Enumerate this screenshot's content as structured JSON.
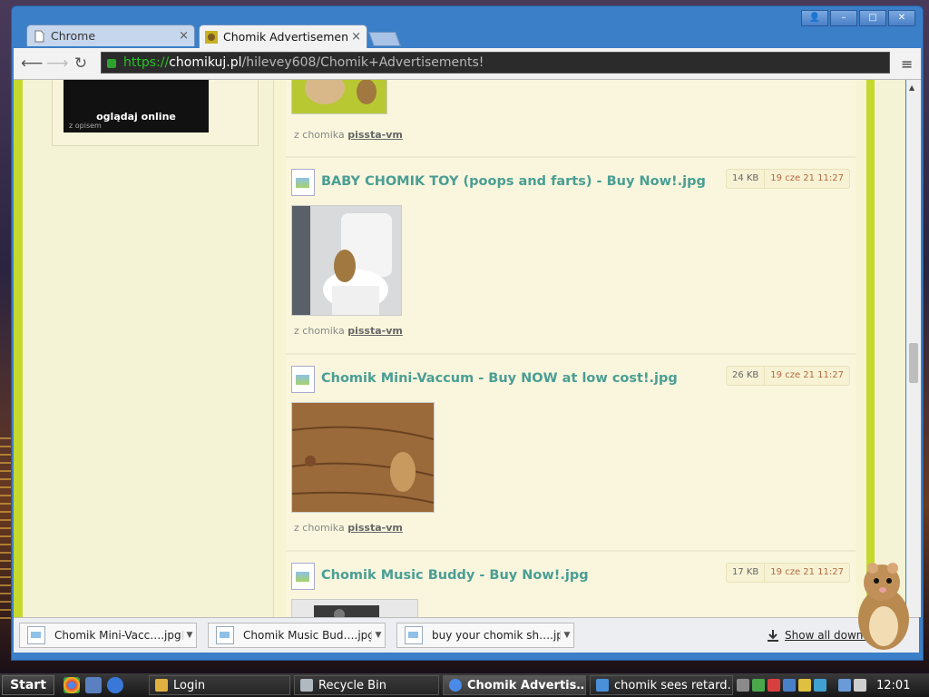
{
  "browser": {
    "tabs": [
      {
        "label": "Chrome",
        "close": "×"
      },
      {
        "label": "Chomik Advertisements!",
        "close": "×"
      }
    ],
    "url": {
      "scheme": "https://",
      "domain": "chomikuj.pl",
      "path": "/hilevey608/Chomik+Advertisements!"
    },
    "window_controls": [
      "👤",
      "–",
      "□",
      "✕"
    ]
  },
  "sidebar": {
    "overlay_text": "oglądaj online",
    "caption": "z opisem"
  },
  "entries": [
    {
      "from_label": "z chomika",
      "user": "pissta-vm"
    },
    {
      "title": "BABY CHOMIK TOY (poops and farts) - Buy Now!.jpg",
      "size": "14 KB",
      "date": "19 cze 21 11:27",
      "from_label": "z chomika",
      "user": "pissta-vm"
    },
    {
      "title": "Chomik Mini-Vaccum - Buy NOW at low cost!.jpg",
      "size": "26 KB",
      "date": "19 cze 21 11:27",
      "from_label": "z chomika",
      "user": "pissta-vm"
    },
    {
      "title": "Chomik Music Buddy - Buy Now!.jpg",
      "size": "17 KB",
      "date": "19 cze 21 11:27"
    }
  ],
  "downloads": {
    "items": [
      "Chomik Mini-Vacc….jpg",
      "Chomik Music Bud….jpg",
      "buy your chomik sh….jpg"
    ],
    "show_all": "Show all downloads"
  },
  "taskbar": {
    "start": "Start",
    "buttons": [
      "Login",
      "Recycle Bin",
      "Chomik Advertis…",
      "chomik sees retard…"
    ],
    "clock": "12:01"
  }
}
